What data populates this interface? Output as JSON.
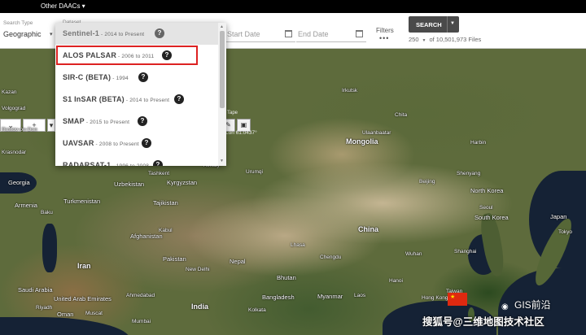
{
  "topbar": {
    "daacs": "Other DAACs ▾"
  },
  "search": {
    "search_type_label": "Search Type",
    "search_type_value": "Geographic",
    "dataset_label": "Dataset",
    "start_date_placeholder": "Start Date",
    "end_date_placeholder": "End Date",
    "filters_label": "Filters",
    "filters_icon": "•••",
    "search_button": "SEARCH",
    "max_results": "250",
    "files_count": "of 10,501,973 Files"
  },
  "map": {
    "toolbar_left": [
      "⌄",
      "+",
      "▾"
    ],
    "tape_label": "Tape",
    "coord_readout": "Lon 61.0437°",
    "places": [
      {
        "name": "Volgograd",
        "cls": "sm"
      },
      {
        "name": "Rostov-on-Don",
        "cls": "sm"
      },
      {
        "name": "Krasnodar",
        "cls": "sm"
      },
      {
        "name": "Georgia",
        "cls": ""
      },
      {
        "name": "Armenia",
        "cls": ""
      },
      {
        "name": "Baku",
        "cls": "sm"
      },
      {
        "name": "Turkmenistan",
        "cls": ""
      },
      {
        "name": "Uzbekistan",
        "cls": ""
      },
      {
        "name": "Kyrgyzstan",
        "cls": ""
      },
      {
        "name": "Tajikistan",
        "cls": ""
      },
      {
        "name": "Afghanistan",
        "cls": ""
      },
      {
        "name": "Pakistan",
        "cls": ""
      },
      {
        "name": "Iran",
        "cls": "big"
      },
      {
        "name": "Saudi Arabia",
        "cls": ""
      },
      {
        "name": "Oman",
        "cls": ""
      },
      {
        "name": "United Arab Emirates",
        "cls": ""
      },
      {
        "name": "Kazan",
        "cls": "sm"
      },
      {
        "name": "Irkutsk",
        "cls": "sm"
      },
      {
        "name": "Chita",
        "cls": "sm"
      },
      {
        "name": "Ulaanbaatar",
        "cls": "sm"
      },
      {
        "name": "Mongolia",
        "cls": "big"
      },
      {
        "name": "Urumqi",
        "cls": "sm"
      },
      {
        "name": "China",
        "cls": "big"
      },
      {
        "name": "Beijing",
        "cls": "sm"
      },
      {
        "name": "Harbin",
        "cls": "sm"
      },
      {
        "name": "Shenyang",
        "cls": "sm"
      },
      {
        "name": "North Korea",
        "cls": ""
      },
      {
        "name": "South Korea",
        "cls": ""
      },
      {
        "name": "Seoul",
        "cls": "sm"
      },
      {
        "name": "Japan",
        "cls": ""
      },
      {
        "name": "Tokyo",
        "cls": "sm"
      },
      {
        "name": "Shanghai",
        "cls": "sm"
      },
      {
        "name": "Chengdu",
        "cls": "sm"
      },
      {
        "name": "Wuhan",
        "cls": "sm"
      },
      {
        "name": "Taiwan",
        "cls": "sm"
      },
      {
        "name": "Hong Kong",
        "cls": "sm"
      },
      {
        "name": "Nepal",
        "cls": ""
      },
      {
        "name": "Bhutan",
        "cls": ""
      },
      {
        "name": "Bangladesh",
        "cls": ""
      },
      {
        "name": "India",
        "cls": "big"
      },
      {
        "name": "Myanmar",
        "cls": ""
      },
      {
        "name": "Laos",
        "cls": "sm"
      },
      {
        "name": "New Delhi",
        "cls": "sm"
      },
      {
        "name": "Kolkata",
        "cls": "sm"
      },
      {
        "name": "Ahmedabad",
        "cls": "sm"
      },
      {
        "name": "Mumbai",
        "cls": "sm"
      },
      {
        "name": "Hanoi",
        "cls": "sm"
      },
      {
        "name": "Lhasa",
        "cls": "sm"
      },
      {
        "name": "Kabul",
        "cls": "sm"
      },
      {
        "name": "Tashkent",
        "cls": "sm"
      },
      {
        "name": "Almaty",
        "cls": "sm"
      },
      {
        "name": "Muscat",
        "cls": "sm"
      },
      {
        "name": "Riyadh",
        "cls": "sm"
      }
    ]
  },
  "dropdown": {
    "items": [
      {
        "name": "Sentinel-1",
        "years": "2014 to Present"
      },
      {
        "name": "ALOS PALSAR",
        "years": "2006 to 2011"
      },
      {
        "name": "SIR-C (BETA)",
        "years": "1994"
      },
      {
        "name": "S1 InSAR (BETA)",
        "years": "2014 to Present"
      },
      {
        "name": "SMAP",
        "years": "2015 to Present"
      },
      {
        "name": "UAVSAR",
        "years": "2008 to Present"
      },
      {
        "name": "RADARSAT-1",
        "years": "1996 to 2008"
      }
    ],
    "separator": " - ",
    "help_glyph": "?"
  },
  "watermark": {
    "brand": "GIS前沿",
    "line": "搜狐号@三维地图技术社区",
    "flag_star": "★"
  },
  "colors": {
    "highlight": "#dd2222",
    "search_button": "#4a4a4a"
  }
}
